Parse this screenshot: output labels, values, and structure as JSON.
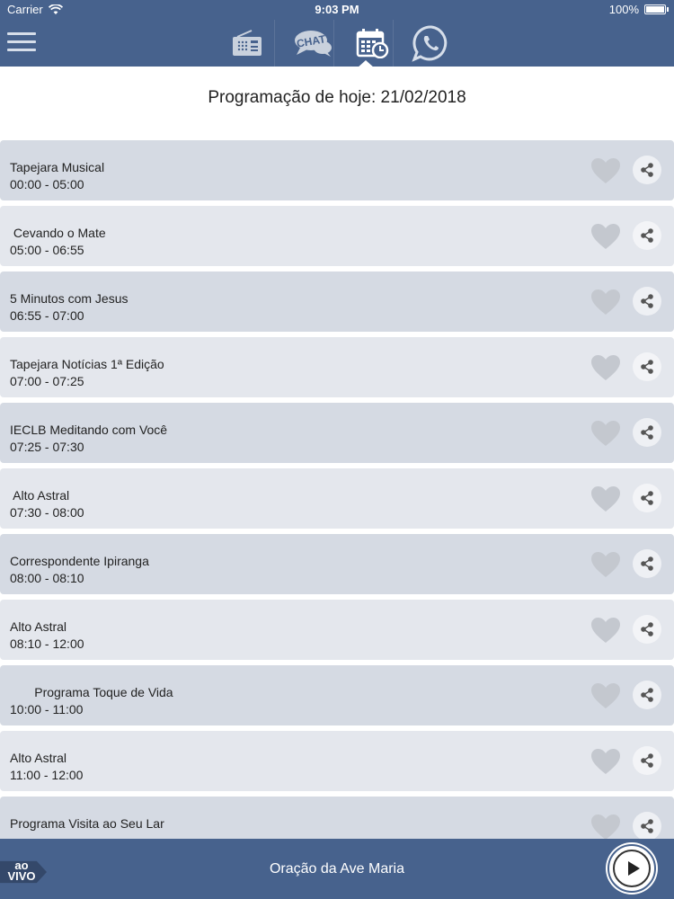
{
  "status_bar": {
    "carrier": "Carrier",
    "time": "9:03 PM",
    "battery": "100%",
    "wifi_icon": "wifi-icon",
    "battery_icon": "battery-icon"
  },
  "navbar": {
    "menu_icon": "hamburger-menu-icon",
    "tabs": [
      {
        "icon": "radio-icon"
      },
      {
        "icon": "chat-icon",
        "label": "CHAT"
      },
      {
        "icon": "calendar-clock-icon",
        "selected": true
      },
      {
        "icon": "whatsapp-icon"
      }
    ]
  },
  "title": "Programação de hoje: 21/02/2018",
  "schedule": [
    {
      "name": "Tapejara Musical",
      "time": "00:00 - 05:00"
    },
    {
      "name": " Cevando o Mate",
      "time": "05:00 - 06:55"
    },
    {
      "name": "5 Minutos com Jesus",
      "time": "06:55 - 07:00"
    },
    {
      "name": "Tapejara Notícias 1ª Edição",
      "time": "07:00 - 07:25"
    },
    {
      "name": "IECLB Meditando com Você",
      "time": "07:25 - 07:30"
    },
    {
      "name": " Alto Astral",
      "time": "07:30 - 08:00"
    },
    {
      "name": "Correspondente Ipiranga",
      "time": "08:00 - 08:10"
    },
    {
      "name": "Alto Astral",
      "time": "08:10 - 12:00"
    },
    {
      "name": "       Programa Toque de Vida",
      "time": "10:00 - 11:00"
    },
    {
      "name": "Alto Astral",
      "time": "11:00 - 12:00"
    },
    {
      "name": "Programa Visita ao Seu Lar",
      "time": ""
    }
  ],
  "player": {
    "live_line1": "ao",
    "live_line2": "VIVO",
    "now_playing": "Oração da Ave Maria",
    "play_icon": "play-icon"
  },
  "colors": {
    "bar": "#47628d",
    "row_odd": "#d5dae3",
    "row_even": "#e4e7ed",
    "heart": "#c4c8cf"
  }
}
